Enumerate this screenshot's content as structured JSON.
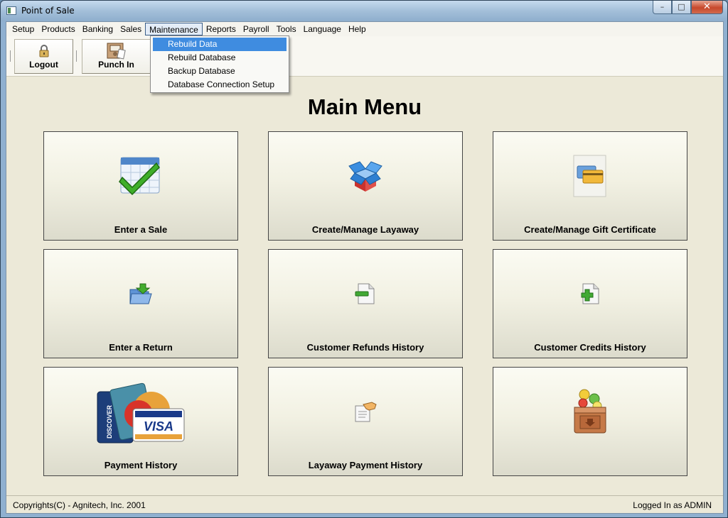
{
  "window": {
    "title": "Point of Sale",
    "minimize": "–",
    "maximize": "□",
    "close": "✕"
  },
  "menu": [
    "Setup",
    "Products",
    "Banking",
    "Sales",
    "Maintenance",
    "Reports",
    "Payroll",
    "Tools",
    "Language",
    "Help"
  ],
  "active_menu": "Maintenance",
  "dropdown": [
    "Rebuild Data",
    "Rebuild Database",
    "Backup Database",
    "Database Connection Setup"
  ],
  "dropdown_highlighted": "Rebuild Data",
  "toolbar": {
    "logout_label": "Logout",
    "punch_in_label": "Punch In"
  },
  "main": {
    "title": "Main Menu",
    "tiles": [
      {
        "label": "Enter a Sale",
        "icon": "checkmark-calendar-icon"
      },
      {
        "label": "Create/Manage Layaway",
        "icon": "open-box-icon"
      },
      {
        "label": "Create/Manage Gift Certificate",
        "icon": "credit-card-icon"
      },
      {
        "label": "Enter a Return",
        "icon": "folder-return-icon"
      },
      {
        "label": "Customer Refunds History",
        "icon": "document-minus-icon"
      },
      {
        "label": "Customer Credits History",
        "icon": "document-plus-icon"
      },
      {
        "label": "Payment History",
        "icon": "credit-cards-icon"
      },
      {
        "label": "Layaway Payment History",
        "icon": "document-hand-icon"
      },
      {
        "label": "",
        "icon": "treasure-chest-icon"
      }
    ]
  },
  "credit_card_logos": [
    "DISCOVER",
    "VISA"
  ],
  "status": {
    "copyright": "Copyrights(C) - Agnitech, Inc. 2001",
    "user": "Logged In as ADMIN"
  }
}
